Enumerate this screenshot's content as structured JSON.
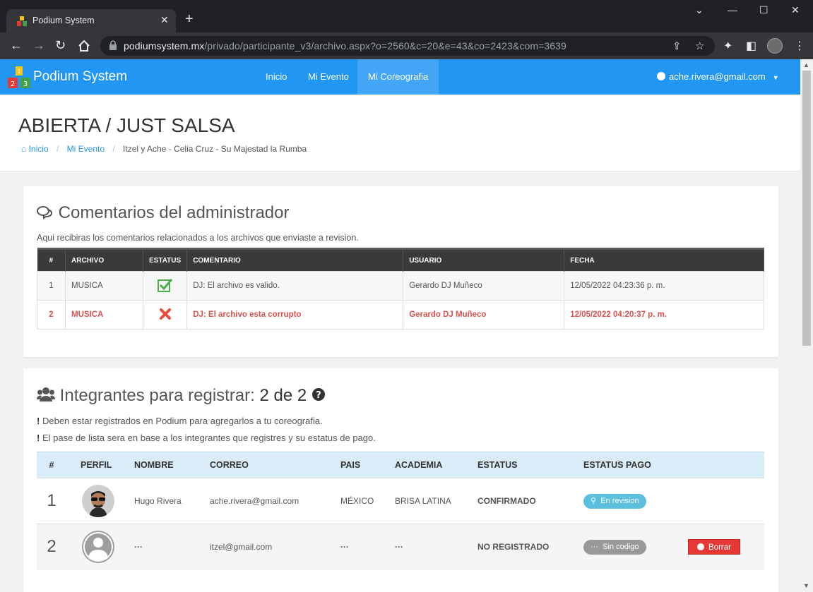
{
  "browser": {
    "tab_title": "Podium System",
    "url_host": "podiumsystem.mx",
    "url_path": "/privado/participante_v3/archivo.aspx?o=2560&c=20&e=43&co=2423&com=3639"
  },
  "navbar": {
    "brand": "Podium System",
    "links": [
      "Inicio",
      "Mi Evento",
      "Mi Coreografia"
    ],
    "active_link": "Mi Coreografia",
    "user_email": "ache.rivera@gmail.com"
  },
  "header": {
    "title": "ABIERTA / JUST SALSA",
    "breadcrumb": [
      "Inicio",
      "Mi Evento",
      "Itzel y Ache - Celia Cruz - Su Majestad la Rumba"
    ]
  },
  "comments": {
    "title": "Comentarios del administrador",
    "description": "Aqui recibiras los comentarios relacionados a los archivos que enviaste a revision.",
    "columns": [
      "#",
      "ARCHIVO",
      "ESTATUS",
      "COMENTARIO",
      "USUARIO",
      "FECHA"
    ],
    "rows": [
      {
        "num": "1",
        "archivo": "MUSICA",
        "status_icon": "check-icon",
        "comentario": "DJ: El archivo es valido.",
        "usuario": "Gerardo DJ Muñeco",
        "fecha": "12/05/2022 04:23:36 p. m."
      },
      {
        "num": "2",
        "archivo": "MUSICA",
        "status_icon": "x-icon",
        "comentario": "DJ: El archivo esta corrupto",
        "usuario": "Gerardo DJ Muñeco",
        "fecha": "12/05/2022 04:20:37 p. m."
      }
    ]
  },
  "members": {
    "title": "Integrantes para registrar:",
    "count": "2 de 2",
    "note1": "Deben estar registrados en Podium para agregarlos a tu coreografia.",
    "note2": "El pase de lista sera en base a los integrantes que registres y su estatus de pago.",
    "columns": [
      "#",
      "PERFIL",
      "NOMBRE",
      "CORREO",
      "PAIS",
      "ACADEMIA",
      "ESTATUS",
      "ESTATUS PAGO"
    ],
    "rows": [
      {
        "num": "1",
        "nombre": "Hugo Rivera",
        "correo": "ache.rivera@gmail.com",
        "pais": "MÉXICO",
        "academia": "BRISA LATINA",
        "estatus": "CONFIRMADO",
        "pago": "En revision"
      },
      {
        "num": "2",
        "nombre": "···",
        "correo": "itzel@gmail.com",
        "pais": "···",
        "academia": "···",
        "estatus": "NO REGISTRADO",
        "pago": "Sin codigo",
        "action": "Borrar"
      }
    ]
  },
  "colors": {
    "navbar": "#2196f3",
    "danger": "#d9534f",
    "success": "#4cae4c",
    "warning": "#f0a30a",
    "info": "#5bc0de"
  }
}
